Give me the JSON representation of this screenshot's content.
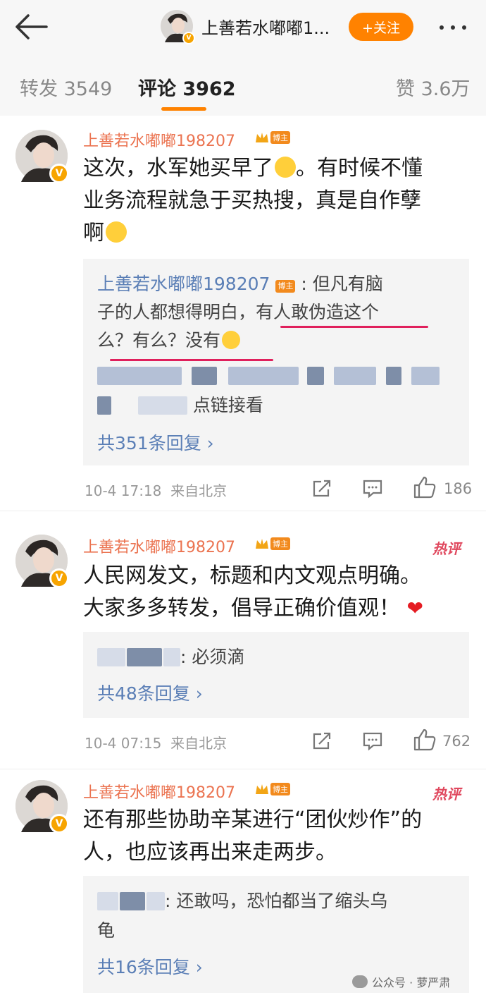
{
  "header": {
    "title": "上善若水嘟嘟1...",
    "follow_label": "+关注",
    "badge_v": "V"
  },
  "tabs": [
    {
      "label": "转发 3549"
    },
    {
      "label": "评论 3962"
    },
    {
      "label": "赞 3.6万"
    }
  ],
  "comments": [
    {
      "user": "上善若水嘟嘟198207",
      "badge": "博主",
      "text_lines": [
        "这次，水军她买早了",
        "业务流程就急于买热搜，真是自作孽",
        "啊"
      ],
      "text_line1_tail": "。有时候不懂",
      "replies": {
        "r1_user": "上善若水嘟嘟198207",
        "r1_badge": "博主",
        "r1_text1": ": 但凡有脑",
        "r1_text2": "子的人都想得明白，有人敢伪造这个",
        "r1_text3": "么？有么？没有",
        "r2_tail": "点链接看",
        "more": "共351条回复 ›"
      },
      "time": "10-4 17:18",
      "location": "来自北京",
      "likes": "186"
    },
    {
      "user": "上善若水嘟嘟198207",
      "badge": "博主",
      "hot": "热评",
      "text_lines": [
        "人民网发文，标题和内文观点明确。",
        "大家多多转发，倡导正确价值观！"
      ],
      "replies": {
        "r1_text": ": 必须滴",
        "more": "共48条回复 ›"
      },
      "time": "10-4 07:15",
      "location": "来自北京",
      "likes": "762"
    },
    {
      "user": "上善若水嘟嘟198207",
      "badge": "博主",
      "hot": "热评",
      "text_lines": [
        "还有那些协助辛某进行“团伙炒作”的",
        "人，也应该再出来走两步。"
      ],
      "replies": {
        "r1_text": ": 还敢吗，恐怕都当了缩头乌",
        "r1_text2": "龟",
        "more": "共16条回复 ›"
      }
    }
  ],
  "watermark": "公众号 · 萝严肃",
  "colors": {
    "accent": "#ff8200",
    "username": "#eb7350",
    "link": "#5b7fb6",
    "hot": "#e0485e",
    "underline": "#e0205c"
  }
}
